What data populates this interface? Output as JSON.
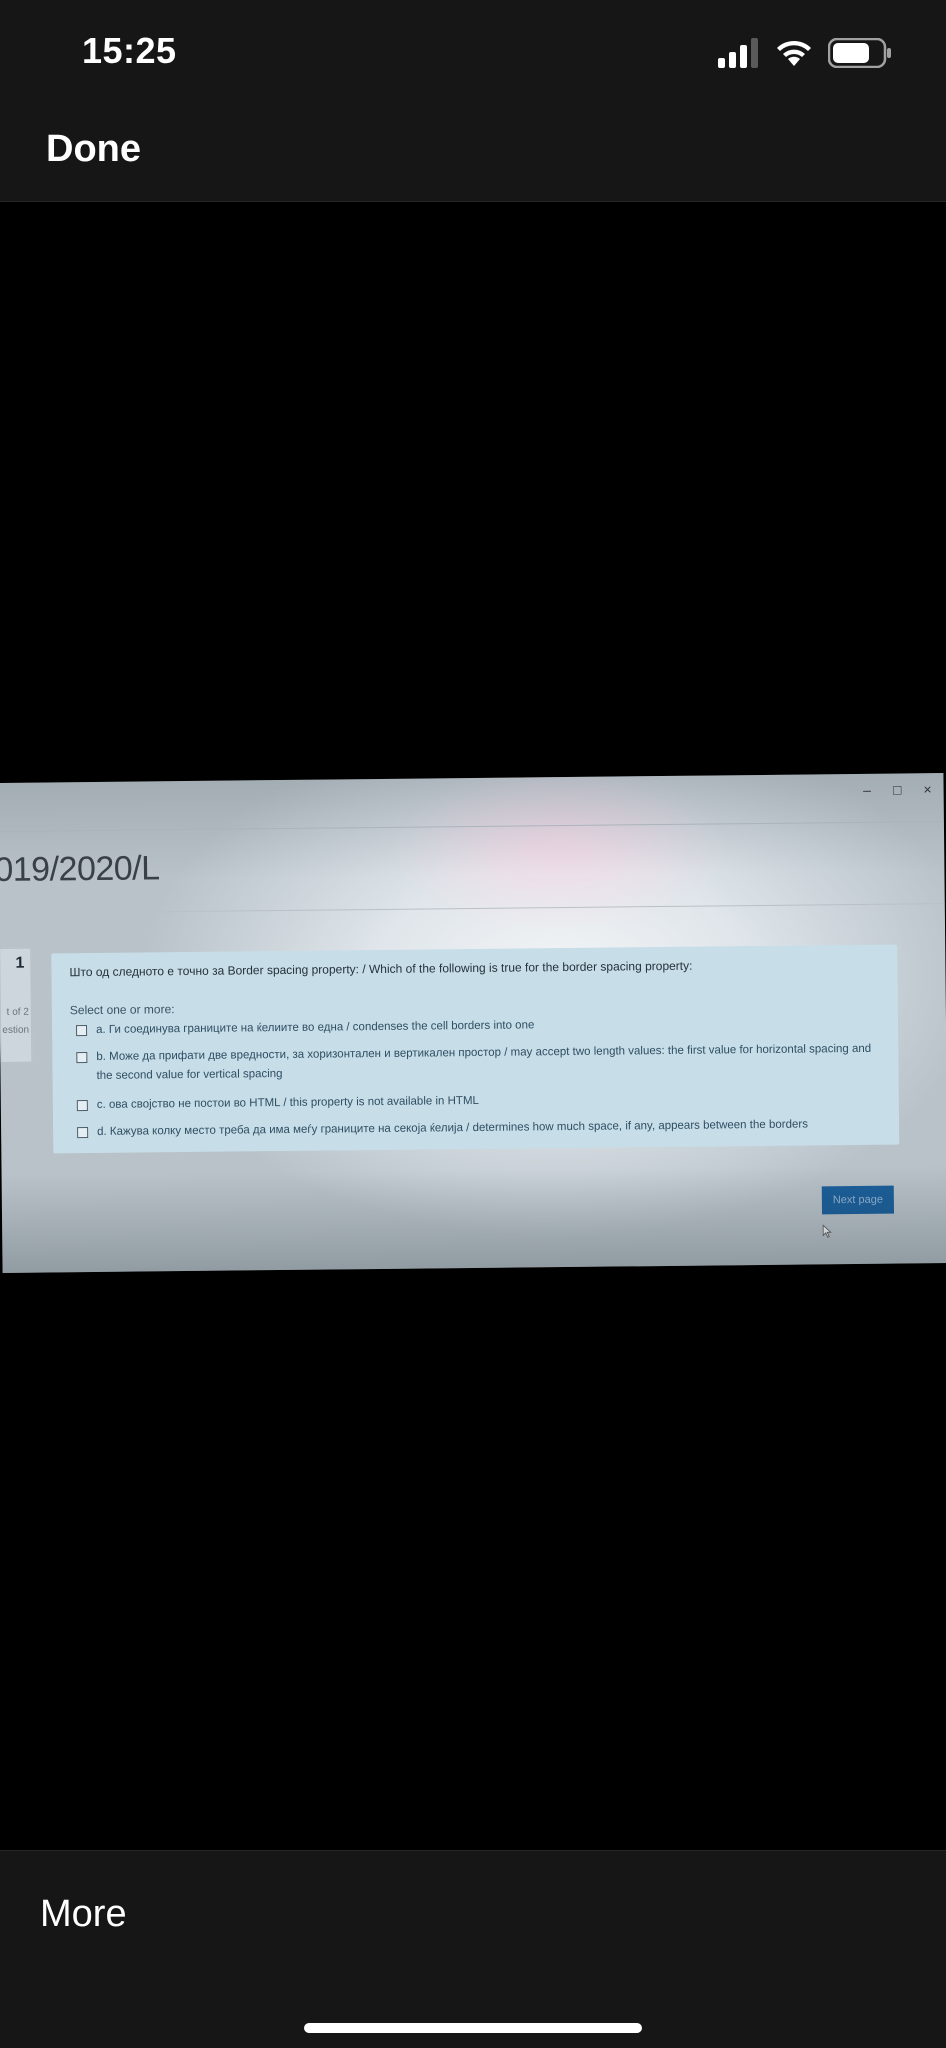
{
  "status_bar": {
    "time": "15:25",
    "icons": [
      "signal-icon",
      "wifi-icon",
      "battery-icon"
    ]
  },
  "nav": {
    "done_label": "Done"
  },
  "photo": {
    "course_title": "019/2020/L",
    "question_nav": {
      "number": "1",
      "line1": "t of 2",
      "line2": "estion"
    },
    "question": {
      "text": "Што од следното е точно за Border spacing property: / Which of the following is true for the border spacing property:",
      "select_hint": "Select one or more:",
      "options": [
        {
          "label": "а. Ги соединува границите на ќелиите во една / condenses the cell borders into one",
          "checked": false
        },
        {
          "label": "b. Може да прифати две вредности, за хоризонтален и вертикален простор / may accept two length values: the first value for horizontal spacing and the second value for vertical spacing",
          "checked": false
        },
        {
          "label": "c. ова својство не постои во HTML / this property is not available in HTML",
          "checked": false
        },
        {
          "label": "d. Кажува колку место треба да има меѓу границите на секоја ќелија / determines how much space, if any, appears between the borders",
          "checked": false
        }
      ]
    },
    "next_label": "Next page",
    "window_controls": [
      "–",
      "□",
      "×"
    ]
  },
  "bottom_bar": {
    "more_label": "More"
  },
  "colors": {
    "chrome_background": "#161616",
    "viewer_background": "#000000",
    "question_box": "#c7dde8",
    "next_button": "#1b5f9a"
  }
}
